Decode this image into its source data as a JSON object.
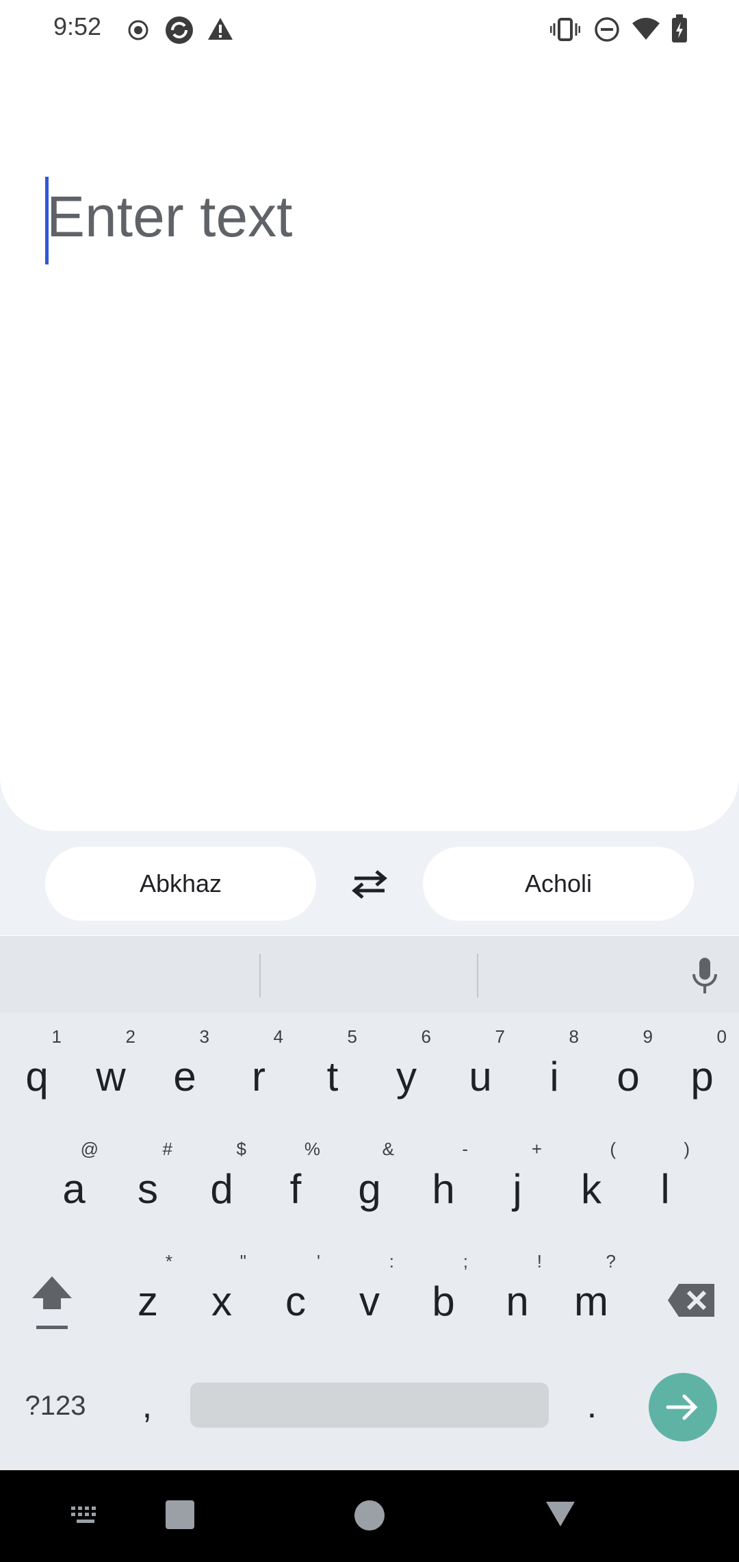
{
  "status_bar": {
    "time": "9:52"
  },
  "app_bar": {
    "back": "back-icon",
    "history": "history-icon",
    "handwriting": "handwriting-icon",
    "more": "more-vert-icon"
  },
  "input": {
    "placeholder": "Enter text",
    "value": ""
  },
  "languages": {
    "source": "Abkhaz",
    "target": "Acholi"
  },
  "keyboard": {
    "row1": [
      {
        "k": "q",
        "s": "1"
      },
      {
        "k": "w",
        "s": "2"
      },
      {
        "k": "e",
        "s": "3"
      },
      {
        "k": "r",
        "s": "4"
      },
      {
        "k": "t",
        "s": "5"
      },
      {
        "k": "y",
        "s": "6"
      },
      {
        "k": "u",
        "s": "7"
      },
      {
        "k": "i",
        "s": "8"
      },
      {
        "k": "o",
        "s": "9"
      },
      {
        "k": "p",
        "s": "0"
      }
    ],
    "row2": [
      {
        "k": "a",
        "s": "@"
      },
      {
        "k": "s",
        "s": "#"
      },
      {
        "k": "d",
        "s": "$"
      },
      {
        "k": "f",
        "s": "%"
      },
      {
        "k": "g",
        "s": "&"
      },
      {
        "k": "h",
        "s": "-"
      },
      {
        "k": "j",
        "s": "+"
      },
      {
        "k": "k",
        "s": "("
      },
      {
        "k": "l",
        "s": ")"
      }
    ],
    "row3": [
      {
        "k": "z",
        "s": "*"
      },
      {
        "k": "x",
        "s": "\""
      },
      {
        "k": "c",
        "s": "'"
      },
      {
        "k": "v",
        "s": ":"
      },
      {
        "k": "b",
        "s": ";"
      },
      {
        "k": "n",
        "s": "!"
      },
      {
        "k": "m",
        "s": "?"
      }
    ],
    "symbols_label": "?123",
    "comma": ",",
    "period": "."
  },
  "colors": {
    "accent_teal": "#5fb3a5",
    "caret_blue": "#2f58d8",
    "keyboard_bg": "#e8ecf0"
  }
}
